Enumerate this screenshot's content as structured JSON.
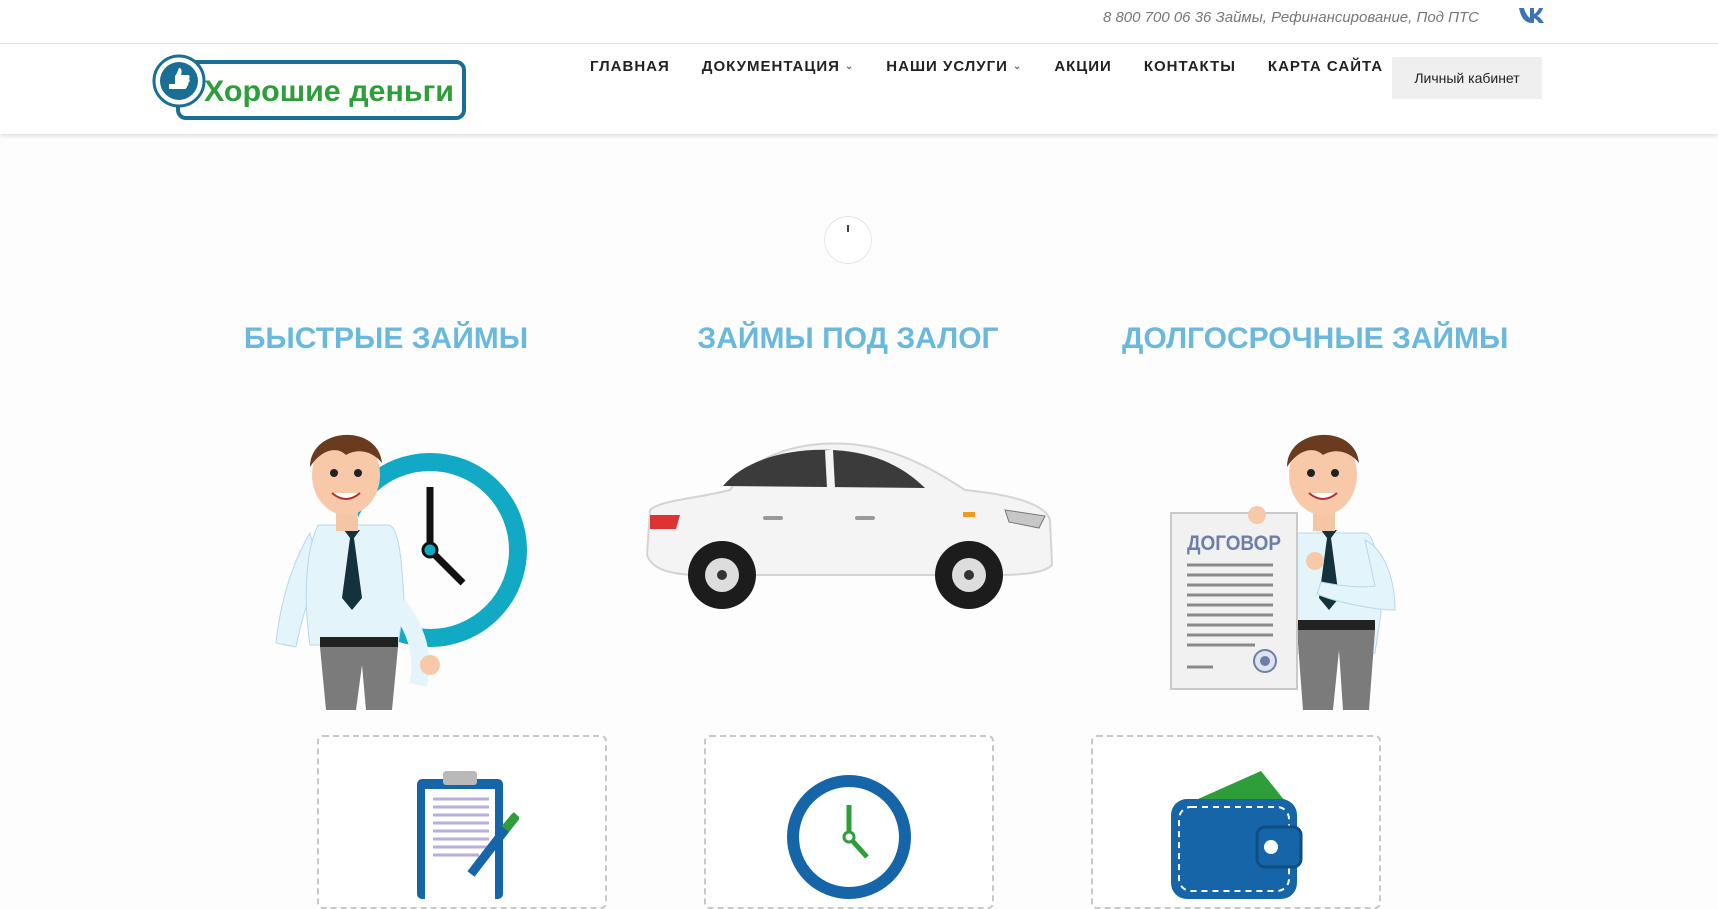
{
  "topbar": {
    "contact_text": "8 800 700 06 36 Займы, Рефинансирование, Под ПТС"
  },
  "logo": {
    "text": "Хорошие деньги"
  },
  "nav": {
    "items": [
      {
        "label": "ГЛАВНАЯ",
        "dropdown": false
      },
      {
        "label": "ДОКУМЕНТАЦИЯ",
        "dropdown": true
      },
      {
        "label": "НАШИ УСЛУГИ",
        "dropdown": true
      },
      {
        "label": "АКЦИИ",
        "dropdown": false
      },
      {
        "label": "КОНТАКТЫ",
        "dropdown": false
      },
      {
        "label": "КАРТА САЙТА",
        "dropdown": false
      }
    ],
    "cabinet_label": "Личный кабинет"
  },
  "sections": [
    {
      "title": "БЫСТРЫЕ ЗАЙМЫ"
    },
    {
      "title": "ЗАЙМЫ ПОД ЗАЛОГ"
    },
    {
      "title": "ДОЛГОСРОЧНЫЕ ЗАЙМЫ"
    }
  ],
  "contract_sign_text": "ДОГОВОР",
  "colors": {
    "accent": "#6ab9dd",
    "logo_green": "#2e9e3a",
    "logo_blue": "#1a6e96",
    "icon_blue": "#1565a8"
  }
}
